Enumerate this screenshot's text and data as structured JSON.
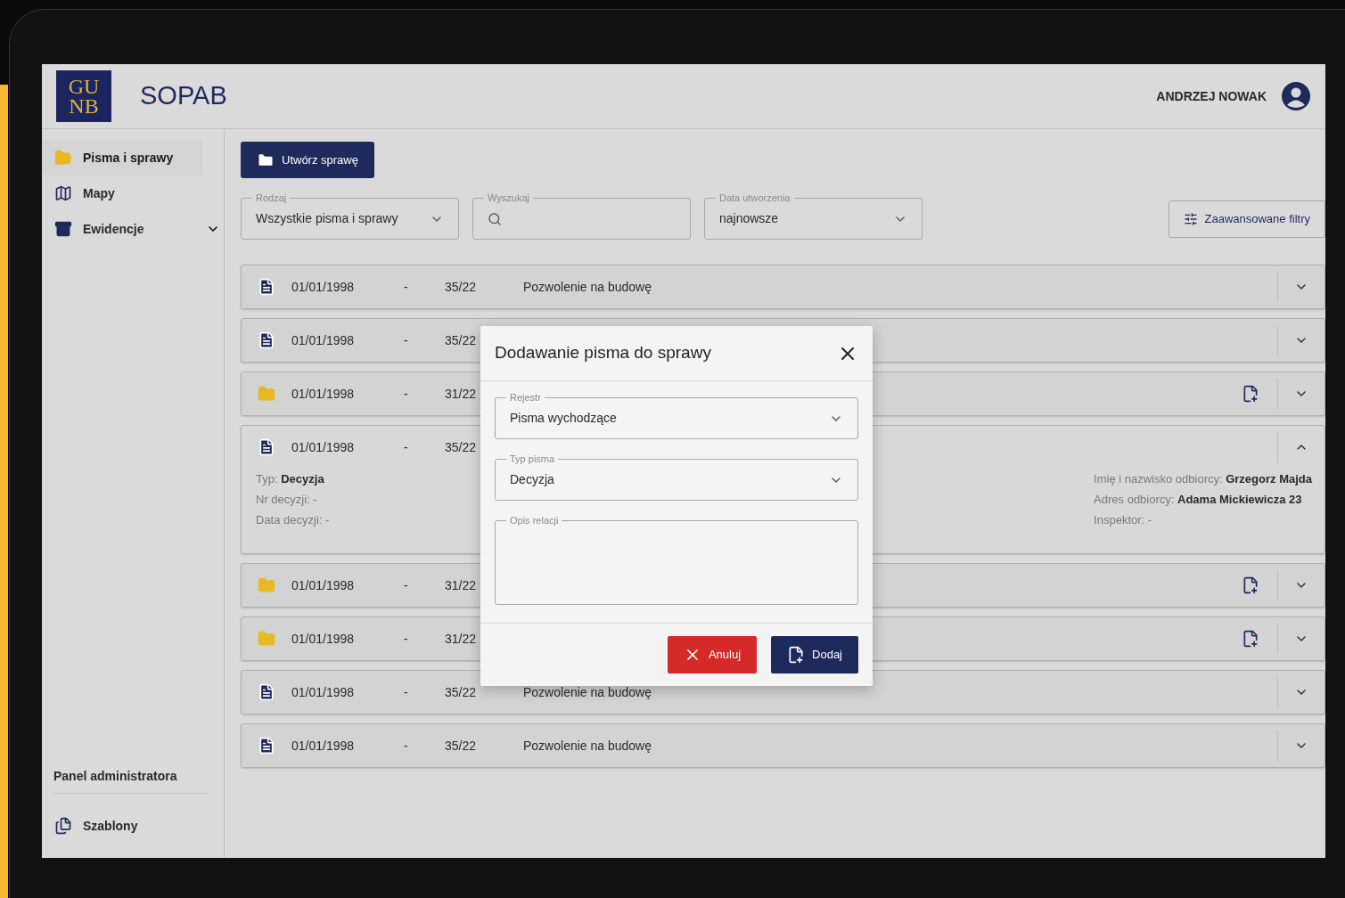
{
  "header": {
    "logo_lines": [
      "GU",
      "NB"
    ],
    "app_name": "SOPAB",
    "user_name": "ANDRZEJ NOWAK"
  },
  "sidebar": {
    "items": [
      {
        "label": "Pisma i sprawy",
        "kind": "cases",
        "selected": true
      },
      {
        "label": "Mapy",
        "kind": "map",
        "selected": false
      },
      {
        "label": "Ewidencje",
        "kind": "archive",
        "selected": false,
        "expanded": false
      }
    ],
    "admin_section": {
      "title": "Panel administratora",
      "items": [
        {
          "label": "Szablony",
          "kind": "templates",
          "selected": false
        }
      ]
    }
  },
  "toolbar": {
    "create_button": "Utwórz sprawę",
    "advanced_filters_button": "Zaawansowane filtry"
  },
  "filters": [
    {
      "kind": "select",
      "label": "Rodzaj",
      "value": "Wszystkie pisma i sprawy"
    },
    {
      "kind": "search",
      "label": "Wyszukaj"
    },
    {
      "kind": "select",
      "label": "Data utworzenia",
      "value": "najnowsze"
    }
  ],
  "rows": [
    {
      "kind": "document",
      "date": "01/01/1998",
      "separator": "-",
      "number": "35/22",
      "title": "Pozwolenie na budowę",
      "expanded": false
    },
    {
      "kind": "document",
      "date": "01/01/1998",
      "separator": "-",
      "number": "35/22",
      "expanded": false
    },
    {
      "kind": "folder",
      "date": "01/01/1998",
      "separator": "-",
      "number": "31/22",
      "expanded": false
    },
    {
      "kind": "document",
      "date": "01/01/1998",
      "separator": "-",
      "number": "35/22",
      "expanded": true,
      "details_left": [
        "Typ: **Decyzja**",
        "Nr decyzji: -",
        "Data decyzji: -"
      ],
      "details_right": [
        "Imię i nazwisko odbiorcy: **Grzegorz Majda**",
        "Adres odbiorcy: **Adama Mickiewicza 23**",
        "Inspektor: -"
      ]
    },
    {
      "kind": "folder",
      "date": "01/01/1998",
      "separator": "-",
      "number": "31/22",
      "expanded": false
    },
    {
      "kind": "folder",
      "date": "01/01/1998",
      "separator": "-",
      "number": "31/22",
      "expanded": false
    },
    {
      "kind": "document",
      "date": "01/01/1998",
      "separator": "-",
      "number": "35/22",
      "title": "Pozwolenie na budowę",
      "expanded": false
    },
    {
      "kind": "document",
      "date": "01/01/1998",
      "separator": "-",
      "number": "35/22",
      "title": "Pozwolenie na budowę",
      "expanded": false
    }
  ],
  "dialog": {
    "title": "Dodawanie pisma do sprawy",
    "fields": [
      {
        "kind": "select",
        "label": "Rejestr",
        "value": "Pisma wychodzące"
      },
      {
        "kind": "select",
        "label": "Typ pisma",
        "value": "Decyzja"
      },
      {
        "kind": "textarea",
        "label": "Opis relacji"
      }
    ],
    "cancel_button": "Anuluj",
    "submit_button": "Dodaj"
  }
}
